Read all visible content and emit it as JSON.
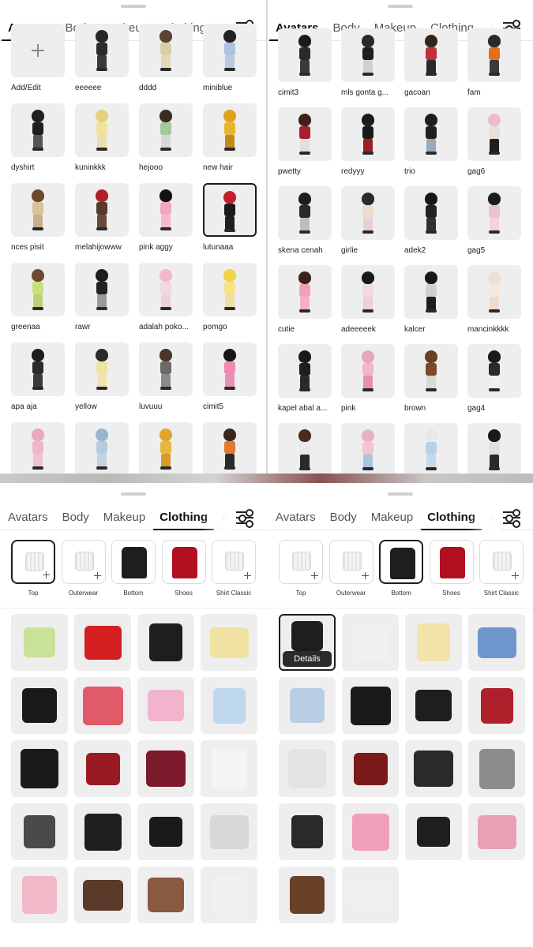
{
  "tabs": [
    "Avatars",
    "Body",
    "Makeup",
    "Clothing",
    "A"
  ],
  "panels": {
    "avatars_left": {
      "active_tab": "Avatars",
      "items": [
        {
          "label": "Add/Edit",
          "kind": "add"
        },
        {
          "label": "eeeeee",
          "hair": "#262626",
          "top": "#2b2b2b",
          "bottom": "#3a3a3a"
        },
        {
          "label": "dddd",
          "hair": "#5a4630",
          "top": "#d8cfa8",
          "bottom": "#e4d9b2"
        },
        {
          "label": "miniblue",
          "hair": "#222222",
          "top": "#a9c3e0",
          "bottom": "#b7cbe3"
        },
        {
          "label": "dyshirt",
          "hair": "#1f1f1f",
          "top": "#1e1e1e",
          "bottom": "#555555"
        },
        {
          "label": "kuninkkk",
          "hair": "#e6d17a",
          "top": "#f0e29a",
          "bottom": "#eadfa8"
        },
        {
          "label": "hejooo",
          "hair": "#3a2a22",
          "top": "#a5c79a",
          "bottom": "#d8d8d8"
        },
        {
          "label": "new hair",
          "hair": "#e0a21c",
          "top": "#e8b530",
          "bottom": "#c58a1a"
        },
        {
          "label": "nces pisit",
          "hair": "#6b4a30",
          "top": "#d8c29a",
          "bottom": "#c9b08a"
        },
        {
          "label": "melahijowww",
          "hair": "#b0202a",
          "top": "#5a3a2a",
          "bottom": "#6a4a36"
        },
        {
          "label": "pink aggy",
          "hair": "#111111",
          "top": "#f2a7c4",
          "bottom": "#f5b8cf"
        },
        {
          "label": "lutunaaa",
          "hair": "#c02030",
          "top": "#1a1a1a",
          "bottom": "#202020",
          "selected": true
        },
        {
          "label": "greenaa",
          "hair": "#6a4a30",
          "top": "#c9e07a",
          "bottom": "#b8d470"
        },
        {
          "label": "rawr",
          "hair": "#1c1c1c",
          "top": "#222222",
          "bottom": "#9a9a9a"
        },
        {
          "label": "adalah poko...",
          "hair": "#f0b8cc",
          "top": "#f3d7e2",
          "bottom": "#efcfdc"
        },
        {
          "label": "pomgo",
          "hair": "#f2d24a",
          "top": "#f6e38a",
          "bottom": "#f0dfa0"
        },
        {
          "label": "apa aja",
          "hair": "#1c1c1c",
          "top": "#2a2a2a",
          "bottom": "#3a3a3a"
        },
        {
          "label": "yellow",
          "hair": "#2a2a2a",
          "top": "#f0e2a0",
          "bottom": "#efe3b0"
        },
        {
          "label": "luvuuu",
          "hair": "#4a3528",
          "top": "#6a6a6a",
          "bottom": "#8a8a8a"
        },
        {
          "label": "cimit5",
          "hair": "#161616",
          "top": "#f08cb0",
          "bottom": "#e890b4"
        },
        {
          "label": "",
          "hair": "#e9a7c0",
          "top": "#f2b5cb",
          "bottom": "#f3c1d3"
        },
        {
          "label": "",
          "hair": "#9ab4cf",
          "top": "#b7cbe0",
          "bottom": "#c3d3e4"
        },
        {
          "label": "",
          "hair": "#e3a42a",
          "top": "#e8b73e",
          "bottom": "#d59a2a"
        },
        {
          "label": "",
          "hair": "#3a2518",
          "top": "#e07a30",
          "bottom": "#2a2a2a"
        }
      ]
    },
    "avatars_right": {
      "active_tab": "Avatars",
      "items": [
        {
          "label": "cimit3",
          "hair": "#1a1a1a",
          "top": "#2a2a2a",
          "bottom": "#3a3a3a"
        },
        {
          "label": "mls gonta g...",
          "hair": "#2a2a2a",
          "top": "#1e1e1e",
          "bottom": "#d0d0d0"
        },
        {
          "label": "gacoan",
          "hair": "#3a2418",
          "top": "#c0303a",
          "bottom": "#2a2a2a"
        },
        {
          "label": "fam",
          "hair": "#2a2a2a",
          "top": "#e0701a",
          "bottom": "#3a3a3a"
        },
        {
          "label": "pwetty",
          "hair": "#3a2418",
          "top": "#a82030",
          "bottom": "#e0e0e0"
        },
        {
          "label": "redyyy",
          "hair": "#1a1a1a",
          "top": "#1a1a1a",
          "bottom": "#9a2024"
        },
        {
          "label": "trio",
          "hair": "#1e1e1e",
          "top": "#202020",
          "bottom": "#9aa9b9"
        },
        {
          "label": "gag6",
          "hair": "#f0b8cc",
          "top": "#e8e0d8",
          "bottom": "#1e1e1e"
        },
        {
          "label": "skena cenah",
          "hair": "#1e1e1e",
          "top": "#2a2a2a",
          "bottom": "#bdbdbd"
        },
        {
          "label": "girlie",
          "hair": "#2a2a2a",
          "top": "#ecdcd0",
          "bottom": "#e8d0d8"
        },
        {
          "label": "adek2",
          "hair": "#161616",
          "top": "#222222",
          "bottom": "#303030"
        },
        {
          "label": "gag5",
          "hair": "#1c1c1c",
          "top": "#f0c0d4",
          "bottom": "#f4d0e0"
        },
        {
          "label": "cutie",
          "hair": "#3a2418",
          "top": "#f2a0b8",
          "bottom": "#f4b0c6"
        },
        {
          "label": "adeeeeek",
          "hair": "#1a1a1a",
          "top": "#f2d8e2",
          "bottom": "#ead0dc"
        },
        {
          "label": "kalcer",
          "hair": "#1a1a1a",
          "top": "#d0d0d0",
          "bottom": "#1e1e1e"
        },
        {
          "label": "mancinkkkk",
          "hair": "#efe0d4",
          "top": "#f6e8de",
          "bottom": "#f0dccf"
        },
        {
          "label": "kapel abal a...",
          "hair": "#1a1a1a",
          "top": "#1e1e1e",
          "bottom": "#2a2a2a"
        },
        {
          "label": "pink",
          "hair": "#e7a4bd",
          "top": "#f0b6c9",
          "bottom": "#e98fae"
        },
        {
          "label": "brown",
          "hair": "#6a4020",
          "top": "#7a4a2a",
          "bottom": "#d8d8d8"
        },
        {
          "label": "gag4",
          "hair": "#1a1a1a",
          "top": "#2a2a2a",
          "bottom": "#f0f0f0"
        },
        {
          "label": "",
          "hair": "#4a2c1c",
          "top": "#e8e8e8",
          "bottom": "#2a2a2a"
        },
        {
          "label": "",
          "hair": "#eab1c6",
          "top": "#f1c3d4",
          "bottom": "#aac4de"
        },
        {
          "label": "",
          "hair": "#e8e8e8",
          "top": "#b8d0e8",
          "bottom": "#c8d8e8"
        },
        {
          "label": "",
          "hair": "#1a1a1a",
          "top": "#e0e0e0",
          "bottom": "#2a2a2a"
        }
      ]
    },
    "clothing_left": {
      "active_tab": "Clothing",
      "categories": [
        {
          "label": "Top",
          "kind": "ghost",
          "active": true
        },
        {
          "label": "Outerwear",
          "kind": "ghost"
        },
        {
          "label": "Bottom",
          "kind": "item",
          "color": "#1e1e1e"
        },
        {
          "label": "Shoes",
          "kind": "item",
          "color": "#b01020"
        },
        {
          "label": "Shirt Classic",
          "kind": "ghost"
        }
      ],
      "items": [
        {
          "color": "#c8e29a"
        },
        {
          "color": "#d42020"
        },
        {
          "color": "#1e1e1e"
        },
        {
          "color": "#f0e2a0"
        },
        {
          "color": "#1a1a1a"
        },
        {
          "color": "#e05a6a"
        },
        {
          "color": "#f2b4cc"
        },
        {
          "color": "#bfd8ee"
        },
        {
          "color": "#1a1a1a"
        },
        {
          "color": "#9a1a24"
        },
        {
          "color": "#7a1a2a"
        },
        {
          "color": "#f4f4f4"
        },
        {
          "color": "#4a4a4a"
        },
        {
          "color": "#1e1e1e"
        },
        {
          "color": "#1a1a1a"
        },
        {
          "color": "#d8d8d8"
        },
        {
          "color": "#f2b8c8"
        },
        {
          "color": "#5a3a28"
        },
        {
          "color": "#8a5a40"
        },
        {
          "color": "#f0f0f0"
        }
      ]
    },
    "clothing_right": {
      "active_tab": "Clothing",
      "categories": [
        {
          "label": "Top",
          "kind": "ghost"
        },
        {
          "label": "Outerwear",
          "kind": "ghost"
        },
        {
          "label": "Bottom",
          "kind": "item",
          "color": "#1e1e1e",
          "active": true
        },
        {
          "label": "Shoes",
          "kind": "item",
          "color": "#b01020"
        },
        {
          "label": "Shirt Classic",
          "kind": "ghost"
        }
      ],
      "details_label": "Details",
      "items": [
        {
          "color": "#1e1e1e",
          "selected": true
        },
        {
          "color": "#f0f0f0"
        },
        {
          "color": "#f2e4a8"
        },
        {
          "color": "#6e96cc"
        },
        {
          "color": "#b9cde4"
        },
        {
          "color": "#1a1a1a"
        },
        {
          "color": "#1e1e1e"
        },
        {
          "color": "#b0202a"
        },
        {
          "color": "#e4e4e4"
        },
        {
          "color": "#7a1a1a"
        },
        {
          "color": "#2a2a2a"
        },
        {
          "color": "#8c8c8c"
        },
        {
          "color": "#2a2a2a"
        },
        {
          "color": "#f0a0b8"
        },
        {
          "color": "#1e1e1e"
        },
        {
          "color": "#e8a0b4"
        },
        {
          "color": "#6a4028"
        },
        {
          "color": "#f0f0f0"
        }
      ]
    }
  }
}
